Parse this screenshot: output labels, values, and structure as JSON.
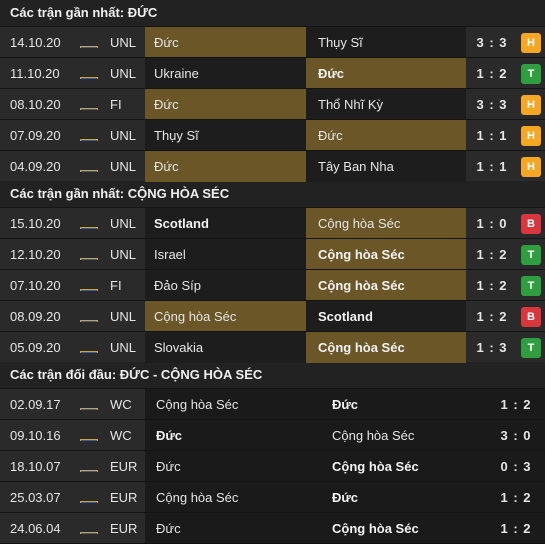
{
  "sections": [
    {
      "title": "Các trận gần nhất: ĐỨC",
      "rows": [
        {
          "date": "14.10.20",
          "league": "UNL",
          "home": "Đức",
          "away": "Thụy Sĩ",
          "score": "3 : 3",
          "result": "H",
          "hl": "home",
          "bold": ""
        },
        {
          "date": "11.10.20",
          "league": "UNL",
          "home": "Ukraine",
          "away": "Đức",
          "score": "1 : 2",
          "result": "T",
          "hl": "away",
          "bold": "away"
        },
        {
          "date": "08.10.20",
          "league": "FI",
          "home": "Đức",
          "away": "Thổ Nhĩ Kỳ",
          "score": "3 : 3",
          "result": "H",
          "hl": "home",
          "bold": ""
        },
        {
          "date": "07.09.20",
          "league": "UNL",
          "home": "Thụy Sĩ",
          "away": "Đức",
          "score": "1 : 1",
          "result": "H",
          "hl": "away",
          "bold": ""
        },
        {
          "date": "04.09.20",
          "league": "UNL",
          "home": "Đức",
          "away": "Tây Ban Nha",
          "score": "1 : 1",
          "result": "H",
          "hl": "home",
          "bold": ""
        }
      ]
    },
    {
      "title": "Các trận gần nhất: CỘNG HÒA SÉC",
      "rows": [
        {
          "date": "15.10.20",
          "league": "UNL",
          "home": "Scotland",
          "away": "Cộng hòa Séc",
          "score": "1 : 0",
          "result": "B",
          "hl": "away",
          "bold": "home"
        },
        {
          "date": "12.10.20",
          "league": "UNL",
          "home": "Israel",
          "away": "Cộng hòa Séc",
          "score": "1 : 2",
          "result": "T",
          "hl": "away",
          "bold": "away"
        },
        {
          "date": "07.10.20",
          "league": "FI",
          "home": "Đảo Síp",
          "away": "Cộng hòa Séc",
          "score": "1 : 2",
          "result": "T",
          "hl": "away",
          "bold": "away"
        },
        {
          "date": "08.09.20",
          "league": "UNL",
          "home": "Cộng hòa Séc",
          "away": "Scotland",
          "score": "1 : 2",
          "result": "B",
          "hl": "home",
          "bold": "away"
        },
        {
          "date": "05.09.20",
          "league": "UNL",
          "home": "Slovakia",
          "away": "Cộng hòa Séc",
          "score": "1 : 3",
          "result": "T",
          "hl": "away",
          "bold": "away"
        }
      ]
    },
    {
      "title": "Các trận đối đầu: ĐỨC - CỘNG HÒA SÉC",
      "h2h": true,
      "rows": [
        {
          "date": "02.09.17",
          "league": "WC",
          "home": "Cộng hòa Séc",
          "away": "Đức",
          "score": "1 : 2",
          "bold": "away"
        },
        {
          "date": "09.10.16",
          "league": "WC",
          "home": "Đức",
          "away": "Cộng hòa Séc",
          "score": "3 : 0",
          "bold": "home"
        },
        {
          "date": "18.10.07",
          "league": "EUR",
          "home": "Đức",
          "away": "Cộng hòa Séc",
          "score": "0 : 3",
          "bold": "away"
        },
        {
          "date": "25.03.07",
          "league": "EUR",
          "home": "Cộng hòa Séc",
          "away": "Đức",
          "score": "1 : 2",
          "bold": "away"
        },
        {
          "date": "24.06.04",
          "league": "EUR",
          "home": "Đức",
          "away": "Cộng hòa Séc",
          "score": "1 : 2",
          "bold": "away"
        }
      ]
    }
  ],
  "icons": {
    "league_flag": "world-flag-icon"
  },
  "colors": {
    "highlight": "#6b5628",
    "draw": "#f5a623",
    "win": "#2e9e3e",
    "loss": "#d9363e"
  }
}
